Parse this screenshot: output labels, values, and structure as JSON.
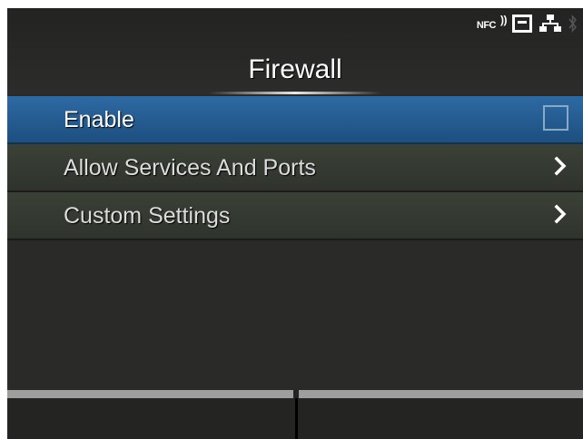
{
  "header": {
    "title": "Firewall",
    "status_icons": {
      "nfc_label": "NFC",
      "icons": [
        "nfc-icon",
        "sd-card-icon",
        "wired-network-icon",
        "bluetooth-icon"
      ]
    }
  },
  "menu": {
    "items": [
      {
        "label": "Enable",
        "control": "checkbox",
        "checked": false,
        "selected": true
      },
      {
        "label": "Allow Services And Ports",
        "control": "chevron",
        "selected": false
      },
      {
        "label": "Custom Settings",
        "control": "chevron",
        "selected": false
      }
    ]
  },
  "softkeys": {
    "left": "",
    "right": ""
  },
  "colors": {
    "background": "#2a2a28",
    "selected_row": "#2d6aa3",
    "row": "#3a4136",
    "softkey_bar": "#9e9e9e"
  }
}
